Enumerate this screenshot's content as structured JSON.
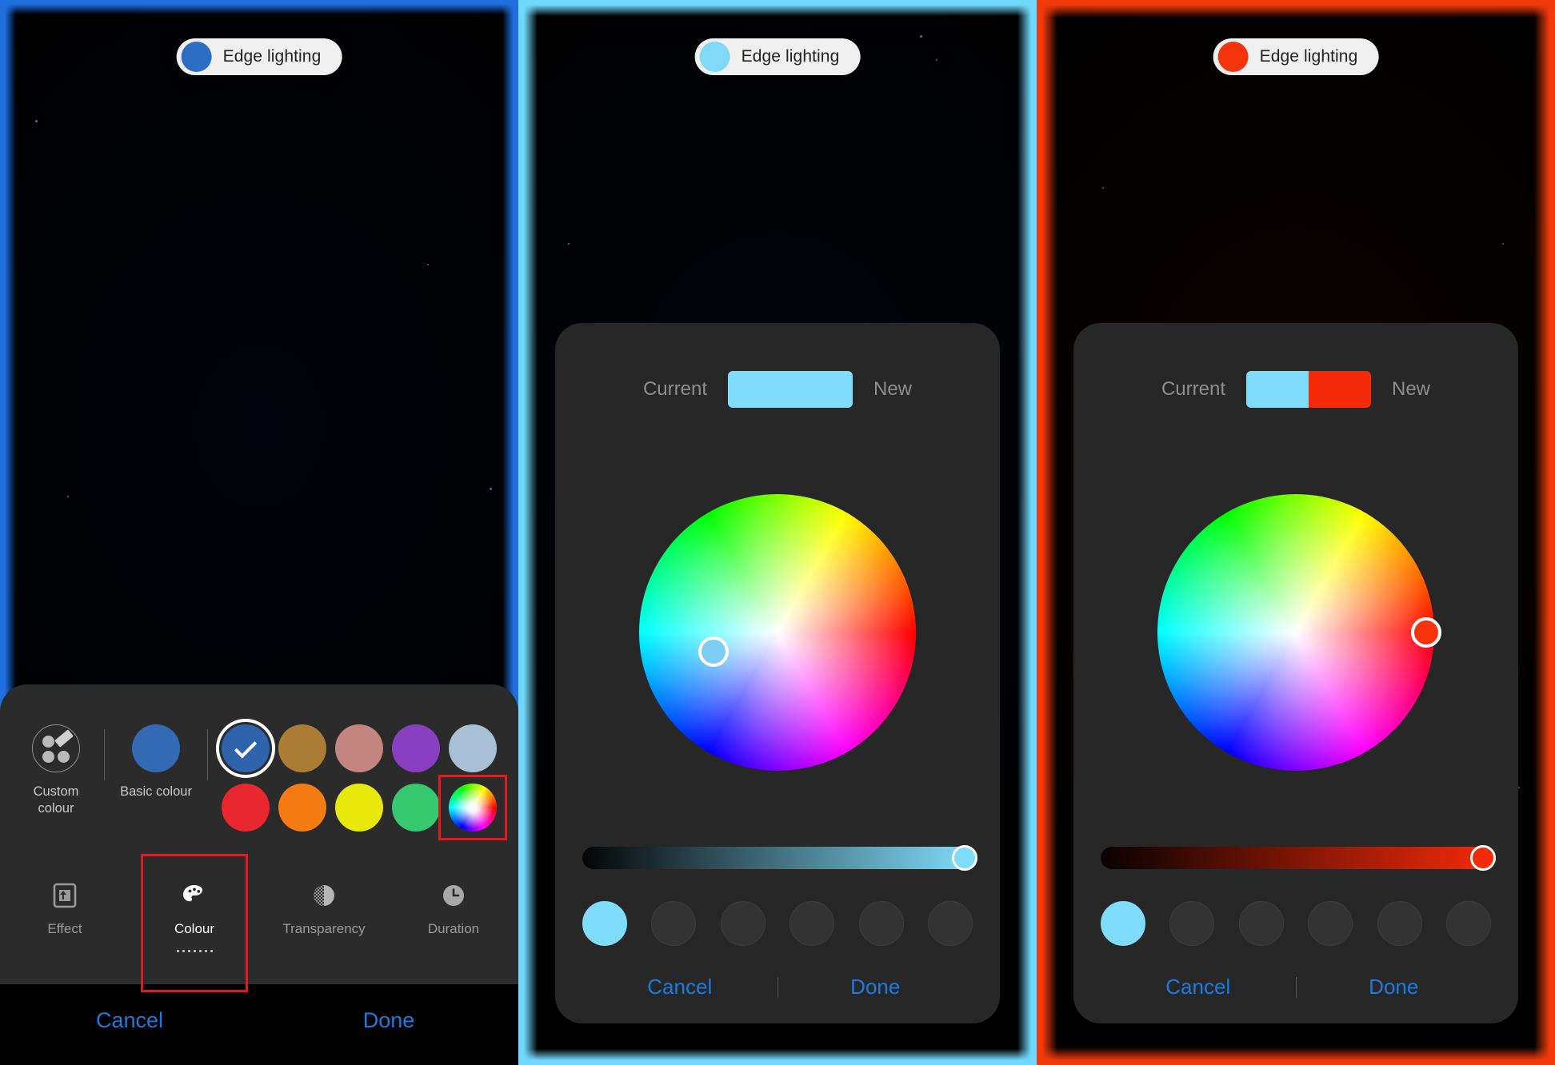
{
  "panels": [
    {
      "id": "panel-basic-colour",
      "edge_glow_color": "#1f6fe0",
      "pill": {
        "label": "Edge lighting",
        "dot_color": "#2c6ec4",
        "icon": "edge-lighting-dot"
      },
      "sheet": {
        "custom_colour": {
          "label": "Custom\ncolour",
          "label_line1": "Custom",
          "label_line2": "colour",
          "icon": "palette-edit-icon"
        },
        "basic_colour": {
          "label": "Basic colour",
          "dot_color": "#3469b4"
        },
        "swatches_row1": [
          {
            "name": "blue",
            "color": "#2f63ab",
            "selected": true
          },
          {
            "name": "bronze",
            "color": "#ab7c33"
          },
          {
            "name": "dusty-rose",
            "color": "#c4857f"
          },
          {
            "name": "purple",
            "color": "#8a3fc0"
          },
          {
            "name": "steel-blue",
            "color": "#a8c0d5"
          }
        ],
        "swatches_row2": [
          {
            "name": "red",
            "color": "#e8282e"
          },
          {
            "name": "orange",
            "color": "#f57c12"
          },
          {
            "name": "yellow",
            "color": "#e8e80b"
          },
          {
            "name": "green",
            "color": "#36c96f"
          },
          {
            "name": "colour-wheel",
            "color": "wheel",
            "highlighted": true
          }
        ],
        "tabs": [
          {
            "name": "effect",
            "label": "Effect",
            "icon": "effect-icon",
            "active": false
          },
          {
            "name": "colour",
            "label": "Colour",
            "icon": "palette-icon",
            "active": true,
            "highlighted": true
          },
          {
            "name": "transparency",
            "label": "Transparency",
            "icon": "transparency-icon",
            "active": false
          },
          {
            "name": "duration",
            "label": "Duration",
            "icon": "clock-icon",
            "active": false
          }
        ],
        "footer": {
          "cancel": "Cancel",
          "done": "Done"
        }
      }
    },
    {
      "id": "panel-picker-cyan",
      "edge_glow_color": "#6fd8fb",
      "pill": {
        "label": "Edge lighting",
        "dot_color": "#7fd9f7",
        "icon": "edge-lighting-dot"
      },
      "dialog": {
        "current_label": "Current",
        "new_label": "New",
        "current_color": "#7fdcfb",
        "new_color": "#7fdcfb",
        "wheel": {
          "cursor_x_pct": 27,
          "cursor_y_pct": 57,
          "cursor_color": "#7fdcfb"
        },
        "slider": {
          "from": "#050505",
          "to": "#7fdcfb",
          "value_pct": 98
        },
        "recents": [
          {
            "name": "recent-1",
            "color": "#7fdcfb",
            "empty": false
          },
          {
            "name": "recent-2",
            "color": "",
            "empty": true
          },
          {
            "name": "recent-3",
            "color": "",
            "empty": true
          },
          {
            "name": "recent-4",
            "color": "",
            "empty": true
          },
          {
            "name": "recent-5",
            "color": "",
            "empty": true
          },
          {
            "name": "recent-6",
            "color": "",
            "empty": true
          }
        ],
        "cancel": "Cancel",
        "done": "Done"
      }
    },
    {
      "id": "panel-picker-red",
      "edge_glow_color": "#f13a0c",
      "pill": {
        "label": "Edge lighting",
        "dot_color": "#f4340d",
        "icon": "edge-lighting-dot"
      },
      "dialog": {
        "current_label": "Current",
        "new_label": "New",
        "current_color": "#7fdcfb",
        "new_color": "#f42a08",
        "wheel": {
          "cursor_x_pct": 97,
          "cursor_y_pct": 50,
          "cursor_color": "#f8330a"
        },
        "slider": {
          "from": "#090101",
          "to": "#f42a08",
          "value_pct": 98
        },
        "recents": [
          {
            "name": "recent-1",
            "color": "#7fdcfb",
            "empty": false
          },
          {
            "name": "recent-2",
            "color": "",
            "empty": true
          },
          {
            "name": "recent-3",
            "color": "",
            "empty": true
          },
          {
            "name": "recent-4",
            "color": "",
            "empty": true
          },
          {
            "name": "recent-5",
            "color": "",
            "empty": true
          },
          {
            "name": "recent-6",
            "color": "",
            "empty": true
          }
        ],
        "cancel": "Cancel",
        "done": "Done"
      }
    }
  ],
  "accent": {
    "link_blue": "#1d7ae0",
    "highlight_red": "#e01b1b"
  }
}
